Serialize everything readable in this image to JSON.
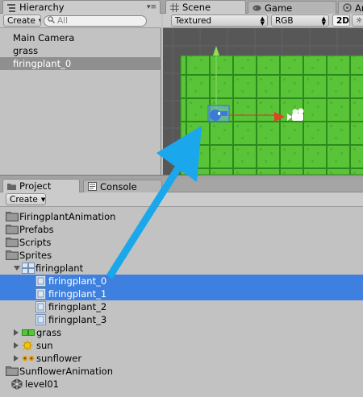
{
  "top_tabs": {
    "hierarchy": "Hierarchy",
    "scene": "Scene",
    "game": "Game",
    "animation": "Anim"
  },
  "hierarchy": {
    "create_label": "Create",
    "search_placeholder": "All",
    "items": [
      {
        "label": "Main Camera",
        "selected": false
      },
      {
        "label": "grass",
        "selected": false
      },
      {
        "label": "firingplant_0",
        "selected": true
      }
    ]
  },
  "scene_toolbar": {
    "render_mode": "Textured",
    "color_mode": "RGB",
    "mode_2d": "2D"
  },
  "bottom_tabs": {
    "project": "Project",
    "console": "Console"
  },
  "project": {
    "create_label": "Create",
    "tree": [
      {
        "label": "FiringplantAnimation",
        "type": "folder",
        "level": 0,
        "expander": "collapsed",
        "selected": false
      },
      {
        "label": "Prefabs",
        "type": "folder",
        "level": 0,
        "expander": "collapsed",
        "selected": false
      },
      {
        "label": "Scripts",
        "type": "folder",
        "level": 0,
        "expander": "collapsed",
        "selected": false
      },
      {
        "label": "Sprites",
        "type": "folder",
        "level": 0,
        "expander": "expanded",
        "selected": false
      },
      {
        "label": "firingplant",
        "type": "spritesheet",
        "level": 1,
        "expander": "expanded",
        "selected": false
      },
      {
        "label": "firingplant_0",
        "type": "sprite",
        "level": 2,
        "expander": "none",
        "selected": true
      },
      {
        "label": "firingplant_1",
        "type": "sprite",
        "level": 2,
        "expander": "none",
        "selected": true
      },
      {
        "label": "firingplant_2",
        "type": "sprite",
        "level": 2,
        "expander": "none",
        "selected": false
      },
      {
        "label": "firingplant_3",
        "type": "sprite",
        "level": 2,
        "expander": "none",
        "selected": false
      },
      {
        "label": "grass",
        "type": "grass-sprite",
        "level": 1,
        "expander": "collapsed",
        "selected": false
      },
      {
        "label": "sun",
        "type": "sun-sprite",
        "level": 1,
        "expander": "collapsed",
        "selected": false
      },
      {
        "label": "sunflower",
        "type": "sunflower-sprite",
        "level": 1,
        "expander": "collapsed",
        "selected": false
      },
      {
        "label": "SunflowerAnimation",
        "type": "folder",
        "level": 0,
        "expander": "collapsed",
        "selected": false
      },
      {
        "label": "level01",
        "type": "scene",
        "level": 0,
        "expander": "none",
        "selected": false
      }
    ]
  },
  "colors": {
    "selection": "#3d80df",
    "grass_tile": "#59c438",
    "grass_edge": "#2c8a1d",
    "arrow": "#1aa7ec"
  }
}
